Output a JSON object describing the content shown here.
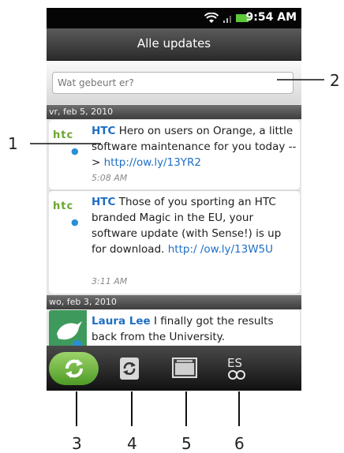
{
  "status_bar": {
    "time": "9:54 AM"
  },
  "title_bar": {
    "title": "Alle updates"
  },
  "compose": {
    "placeholder": "Wat gebeurt er?"
  },
  "groups": [
    {
      "date": "vr, feb 5, 2010",
      "tweets": [
        {
          "author": "HTC",
          "text": "Hero on users on Orange, a little software maintenance for you today -->",
          "link": "http://ow.ly/13YR2",
          "time": "5:08 AM",
          "logo": "htc"
        },
        {
          "author": "HTC",
          "text": "Those of you sporting an HTC branded Magic in the EU, your software update (with Sense!) is up for download.",
          "link": "http:/ /ow.ly/13W5U",
          "time": "3:11 AM",
          "logo": "htc"
        }
      ]
    },
    {
      "date": "wo, feb 3, 2010",
      "tweets": [
        {
          "author": "Laura Lee",
          "text": "I finally got the results back from the University.",
          "link": "",
          "time": ""
        }
      ]
    }
  ],
  "toolbar": {
    "buttons": [
      "refresh-icon",
      "sync-icon",
      "photo-icon",
      "lookup-icon"
    ]
  },
  "callouts": {
    "n1": "1",
    "n2": "2",
    "n3": "3",
    "n4": "4",
    "n5": "5",
    "n6": "6"
  },
  "colors": {
    "accent": "#1f6fc3",
    "htc_green": "#6aa62e",
    "refresh_green": "#72b83f"
  }
}
